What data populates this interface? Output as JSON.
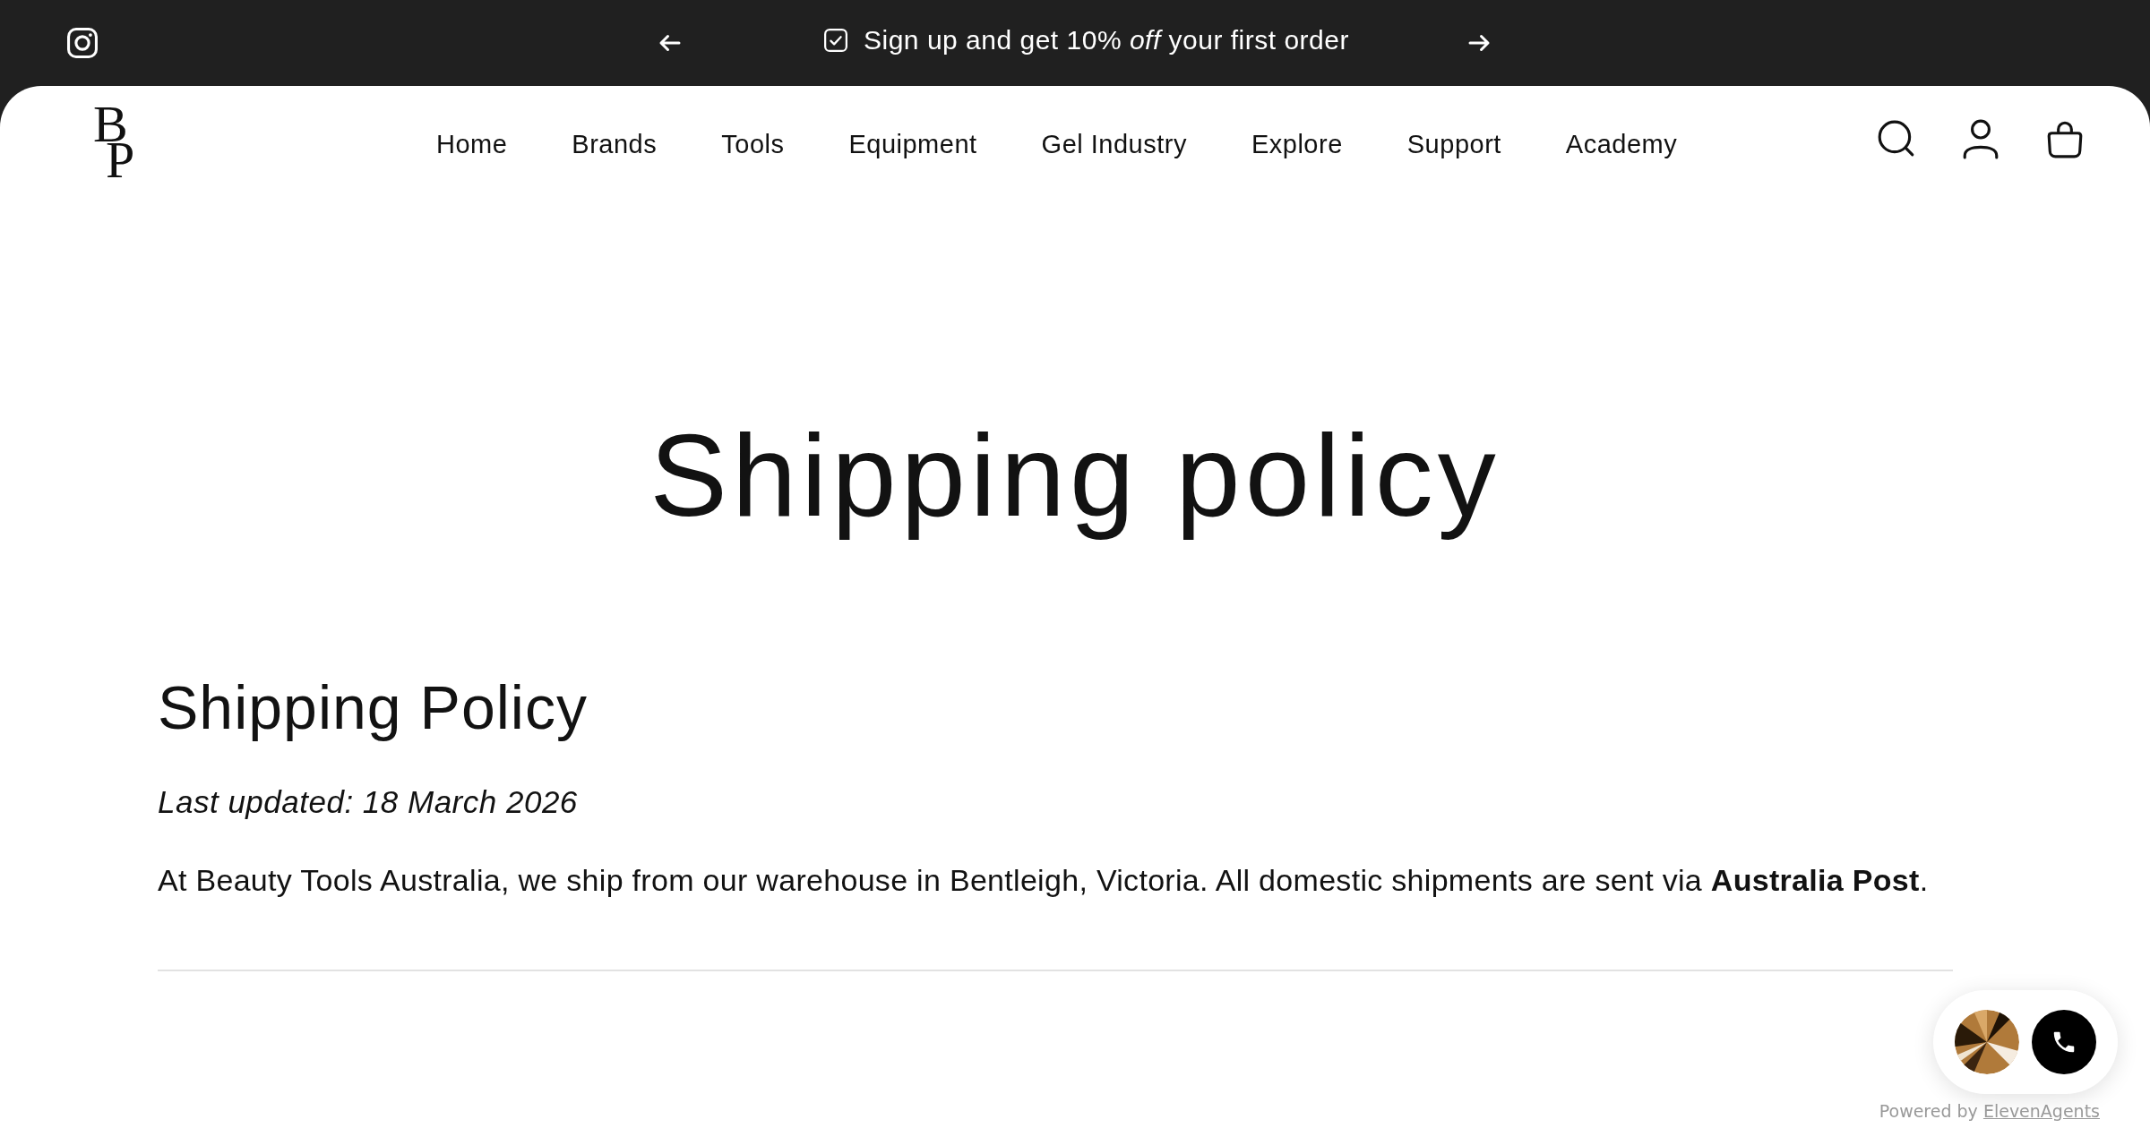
{
  "announcement": {
    "text": "Sign up and get 10% *off* your first order"
  },
  "logo": {
    "letters": [
      "B",
      "P"
    ]
  },
  "nav": {
    "items": [
      "Home",
      "Brands",
      "Tools",
      "Equipment",
      "Gel Industry",
      "Explore",
      "Support",
      "Academy"
    ]
  },
  "page": {
    "title": "Shipping policy",
    "heading": "Shipping Policy",
    "updated": "Last updated: 18 March 2026",
    "intro": "At Beauty Tools Australia, we ship from our warehouse in Bentleigh, Victoria. All domestic shipments are sent via **Australia Post**."
  },
  "widget": {
    "powered_by": "Powered by",
    "brand": "ElevenAgents"
  }
}
